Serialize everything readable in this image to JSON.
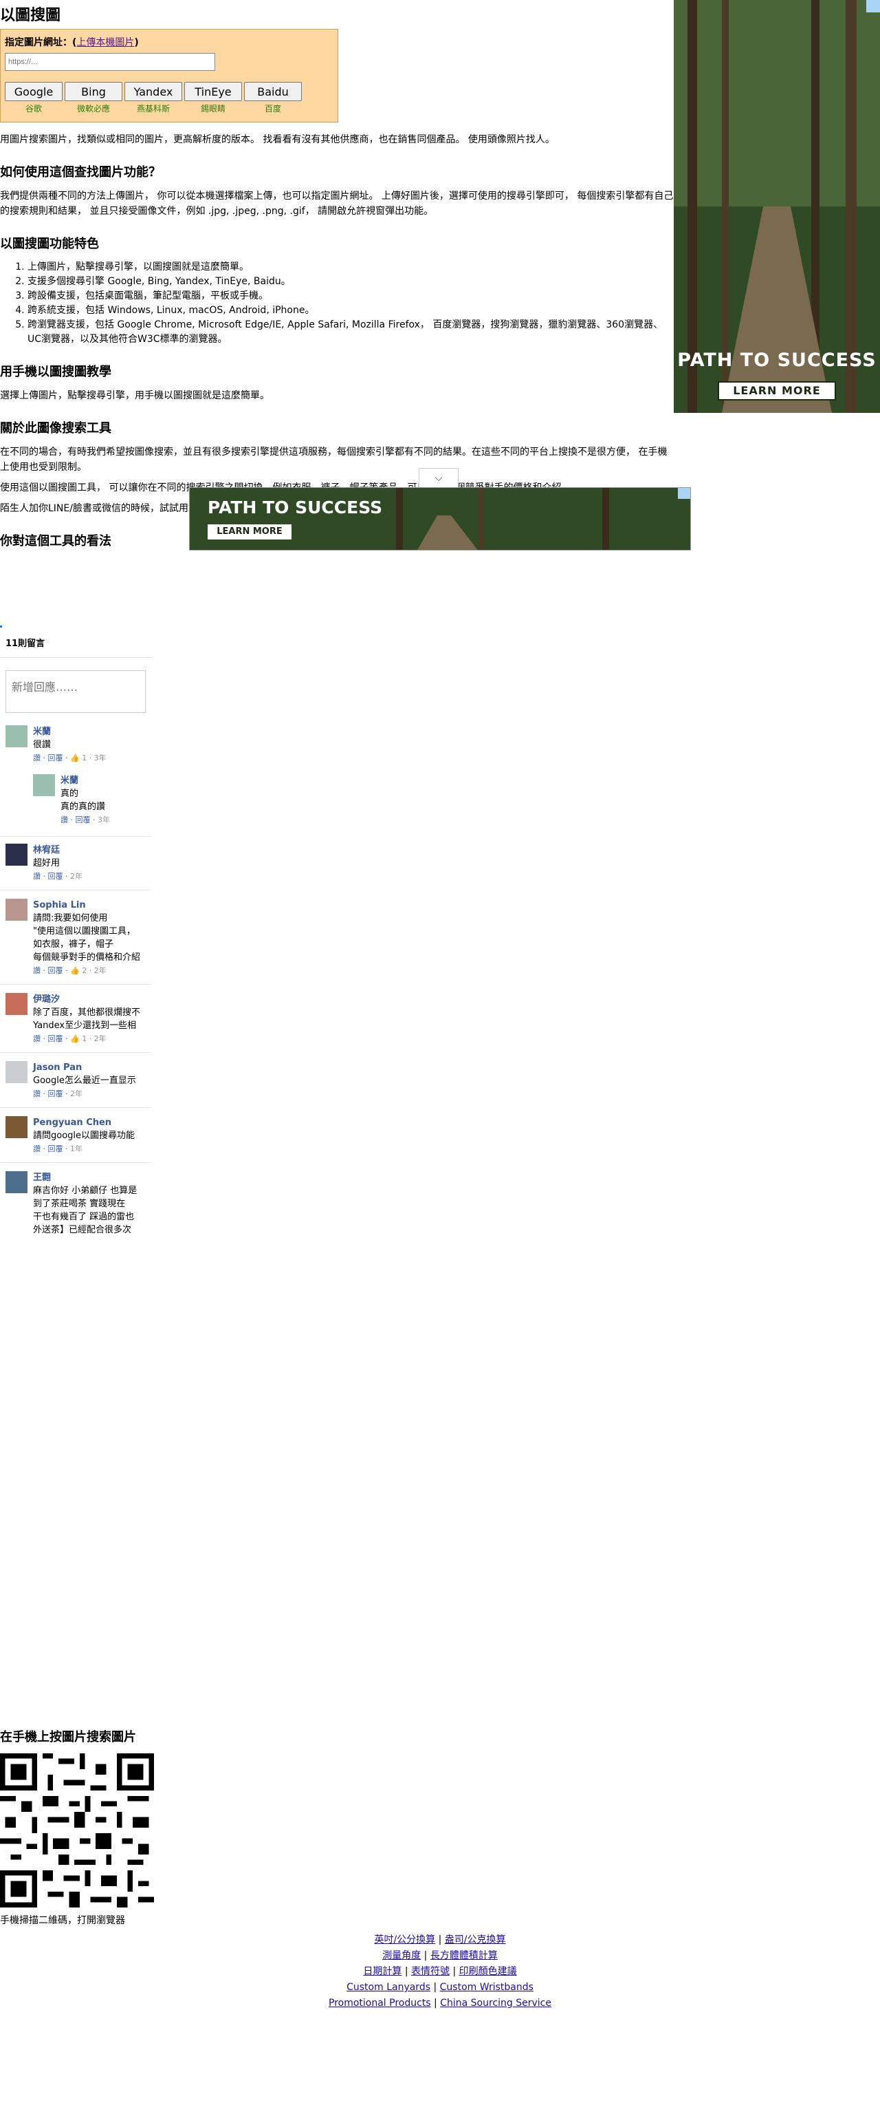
{
  "page": {
    "title": "以圖搜圖",
    "search": {
      "label": "指定圖片網址：",
      "upload_link": "上傳本機圖片",
      "placeholder": "https://...",
      "engines": [
        {
          "label": "Google",
          "sub": "谷歌"
        },
        {
          "label": "Bing",
          "sub": "微軟必應"
        },
        {
          "label": "Yandex",
          "sub": "燕基科斯"
        },
        {
          "label": "TinEye",
          "sub": "錫眼睛"
        },
        {
          "label": "Baidu",
          "sub": "百度"
        }
      ]
    },
    "intro": "用圖片搜索圖片，找類似或相同的圖片，更高解析度的版本。 找看看有沒有其他供應商，也在銷售同個產品。 使用頭像照片找人。",
    "sections": {
      "how_title": "如何使用這個查找圖片功能？",
      "how_text": "我們提供兩種不同的方法上傳圖片， 你可以從本機選擇檔案上傳，也可以指定圖片網址。 上傳好圖片後，選擇可使用的搜尋引擎即可， 每個搜索引擎都有自己的搜索規則和結果， 並且只接受圖像文件，例如 .jpg, .jpeg, .png, .gif， 請開啟允許視窗彈出功能。",
      "features_title": "以圖搜圖功能特色",
      "features": [
        "上傳圖片，點擊搜尋引擎，以圖搜圖就是這麼簡單。",
        "支援多個搜尋引擎 Google, Bing, Yandex, TinEye, Baidu。",
        "跨設備支援，包括桌面電腦，筆記型電腦，平板或手機。",
        "跨系統支援，包括 Windows, Linux, macOS, Android, iPhone。",
        "跨瀏覽器支援，包括 Google Chrome, Microsoft Edge/IE, Apple Safari, Mozilla Firefox， 百度瀏覽器，搜狗瀏覽器，獵豹瀏覽器、360瀏覽器、UC瀏覽器，以及其他符合W3C標準的瀏覽器。"
      ],
      "mobile_title": "用手機以圖搜圖教學",
      "mobile_text": "選擇上傳圖片，點擊搜尋引擎，用手機以圖搜圖就是這麼簡單。",
      "about_title": "關於此圖像搜索工具",
      "about_text1": "在不同的場合，有時我們希望按圖像搜索，並且有很多搜索引擎提供這項服務，每個搜索引擎都有不同的結果。在這些不同的平台上搜換不是很方便， 在手機上使用也受到限制。",
      "about_text2": "使用這個以圖搜圖工具， 可以讓你在不同的搜索引擎之間切換。例如衣服，褲子，帽子等產品，可以比較每個競爭對手的價格和介紹。",
      "about_text3": "陌生人加你LINE/臉書或微信的時候，試試用對方頭像照片搜索，說不定你會有新發現，也許是網紅或是名人。",
      "opinion_title": "你對這個工具的看法"
    },
    "comments": {
      "count_label": "11則留言",
      "placeholder": "新增回應……",
      "items": [
        {
          "name": "米蘭",
          "text": "很讚",
          "text2": "",
          "text3": "",
          "text4": "",
          "meta": "讚 · 回覆 · ",
          "likes": "1",
          "age": " · 3年",
          "avatar_color": "#9bbfae"
        },
        {
          "name": "米蘭",
          "text": "真的",
          "text2": "真的真的讚",
          "text3": "",
          "text4": "",
          "meta": "讚 · 回覆 · ",
          "likes": "",
          "age": "3年",
          "avatar_color": "#9bbfae"
        },
        {
          "name": "林宥廷",
          "text": "超好用",
          "text2": "",
          "text3": "",
          "text4": "",
          "meta": "讚 · 回覆 · ",
          "likes": "",
          "age": "2年",
          "avatar_color": "#2b2e4a"
        },
        {
          "name": "Sophia Lin",
          "text": "請問:我要如何使用",
          "text2": "\"使用這個以圖搜圖工具，",
          "text3": "如衣服，褲子，帽子",
          "text4": "每個競爭對手的價格和介紹",
          "meta": "讚 · 回覆 · ",
          "likes": "2",
          "age": " · 2年",
          "avatar_color": "#b9958f"
        },
        {
          "name": "伊璐汐",
          "text": "除了百度，其他都很爛搜不",
          "text2": "Yandex至少還找到一些相",
          "text3": "",
          "text4": "",
          "meta": "讚 · 回覆 · ",
          "likes": "1",
          "age": " · 2年",
          "avatar_color": "#c86d5c"
        },
        {
          "name": "Jason Pan",
          "text": "Google怎么最近一直显示",
          "text2": "",
          "text3": "",
          "text4": "",
          "meta": "讚 · 回覆 · ",
          "likes": "",
          "age": "2年",
          "avatar_color": "#c9ccd1"
        },
        {
          "name": "Pengyuan Chen",
          "text": "請問google以圖搜尋功能",
          "text2": "",
          "text3": "",
          "text4": "",
          "meta": "讚 · 回覆 · ",
          "likes": "",
          "age": "1年",
          "avatar_color": "#7a5a34"
        },
        {
          "name": "王翾",
          "text": "麻吉你好 小弟顧仔 也算是",
          "text2": "到了茶莊喝茶 實踐現在",
          "text3": "干也有幾百了 踩過的雷也",
          "text4": "外送茶】已經配合很多次",
          "meta": "",
          "likes": "",
          "age": "",
          "avatar_color": "#4d6f8d"
        }
      ]
    },
    "qr": {
      "title": "在手機上按圖片搜索圖片",
      "caption": "手機掃描二維碼，打開瀏覽器"
    },
    "footer": {
      "links": [
        [
          "英吋/公分換算",
          "盎司/公克換算"
        ],
        [
          "測量角度",
          "長方體體積計算"
        ],
        [
          "日期計算",
          "表情符號",
          "印刷顏色建議"
        ],
        [
          "Custom Lanyards",
          "Custom Wristbands"
        ],
        [
          "Promotional Products",
          "China Sourcing Service"
        ]
      ]
    },
    "ads": {
      "side_text": "PATH TO SUCCESS",
      "side_button": "LEARN MORE",
      "overlay_text": "PATH TO SUCCESS",
      "overlay_button": "LEARN MORE"
    }
  }
}
